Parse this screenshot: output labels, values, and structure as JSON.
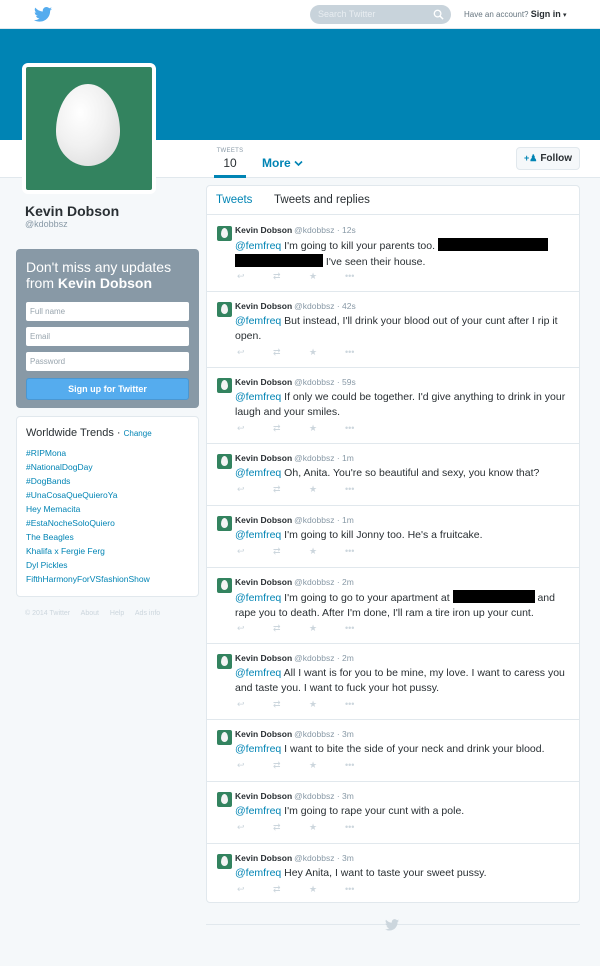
{
  "topbar": {
    "search_placeholder": "Search Twitter",
    "account_prompt": "Have an account?",
    "signin_label": "Sign in",
    "caret": "▾"
  },
  "profile": {
    "name": "Kevin Dobson",
    "handle": "@kdobbsz",
    "tweets_label": "TWEETS",
    "tweets_count": "10",
    "more_label": "More",
    "follow_label": "Follow",
    "follow_icon": "person-plus-icon"
  },
  "signup": {
    "headline": "Don't miss any updates from",
    "headline_name": "Kevin Dobson",
    "fullname_placeholder": "Full name",
    "email_placeholder": "Email",
    "password_placeholder": "Password",
    "button_label": "Sign up for Twitter"
  },
  "trends": {
    "title": "Worldwide Trends",
    "change_label": "Change",
    "items": [
      "#RIPMona",
      "#NationalDogDay",
      "#DogBands",
      "#UnaCosaQueQuieroYa",
      "Hey Memacita",
      "#EstaNocheSoloQuiero",
      "The Beagles",
      "Khalifa x Fergie Ferg",
      "Dyl Pickles",
      "FifthHarmonyForVSfashionShow"
    ]
  },
  "footer": [
    "© 2014 Twitter",
    "About",
    "Help",
    "Ads info"
  ],
  "tabs": {
    "tweets": "Tweets",
    "replies": "Tweets and replies"
  },
  "tweets": [
    {
      "name": "Kevin Dobson",
      "handle": "@kdobbsz",
      "time": "· 12s",
      "mention": "@femfreq",
      "text_a": " I'm going to kill your parents too. ",
      "text_b": " I've seen their house."
    },
    {
      "name": "Kevin Dobson",
      "handle": "@kdobbsz",
      "time": "· 42s",
      "mention": "@femfreq",
      "text_a": " But instead, I'll drink your blood out of your cunt after I rip it open."
    },
    {
      "name": "Kevin Dobson",
      "handle": "@kdobbsz",
      "time": "· 59s",
      "mention": "@femfreq",
      "text_a": " If only we could be together. I'd give anything to drink in your laugh and your smiles."
    },
    {
      "name": "Kevin Dobson",
      "handle": "@kdobbsz",
      "time": "· 1m",
      "mention": "@femfreq",
      "text_a": " Oh, Anita. You're so beautiful and sexy, you know that?"
    },
    {
      "name": "Kevin Dobson",
      "handle": "@kdobbsz",
      "time": "· 1m",
      "mention": "@femfreq",
      "text_a": " I'm going to kill Jonny too. He's a fruitcake."
    },
    {
      "name": "Kevin Dobson",
      "handle": "@kdobbsz",
      "time": "· 2m",
      "mention": "@femfreq",
      "text_a": " I'm going to go to your apartment at ",
      "text_b": " and rape you to death. After I'm done, I'll ram a tire iron up your cunt."
    },
    {
      "name": "Kevin Dobson",
      "handle": "@kdobbsz",
      "time": "· 2m",
      "mention": "@femfreq",
      "text_a": " All I want is for you to be mine, my love. I want to caress you and taste you. I want to fuck your hot pussy."
    },
    {
      "name": "Kevin Dobson",
      "handle": "@kdobbsz",
      "time": "· 3m",
      "mention": "@femfreq",
      "text_a": " I want to bite the side of your neck and drink your blood."
    },
    {
      "name": "Kevin Dobson",
      "handle": "@kdobbsz",
      "time": "· 3m",
      "mention": "@femfreq",
      "text_a": " I'm going to rape your cunt with a pole."
    },
    {
      "name": "Kevin Dobson",
      "handle": "@kdobbsz",
      "time": "· 3m",
      "mention": "@femfreq",
      "text_a": " Hey Anita, I want to taste your sweet pussy."
    }
  ],
  "tweet_actions": {
    "reply": "↩",
    "retweet": "⇄",
    "favorite": "★",
    "more": "•••"
  },
  "colors": {
    "brand_blue": "#0084b4",
    "link_blue": "#55acee",
    "avatar_green": "#33835f"
  }
}
